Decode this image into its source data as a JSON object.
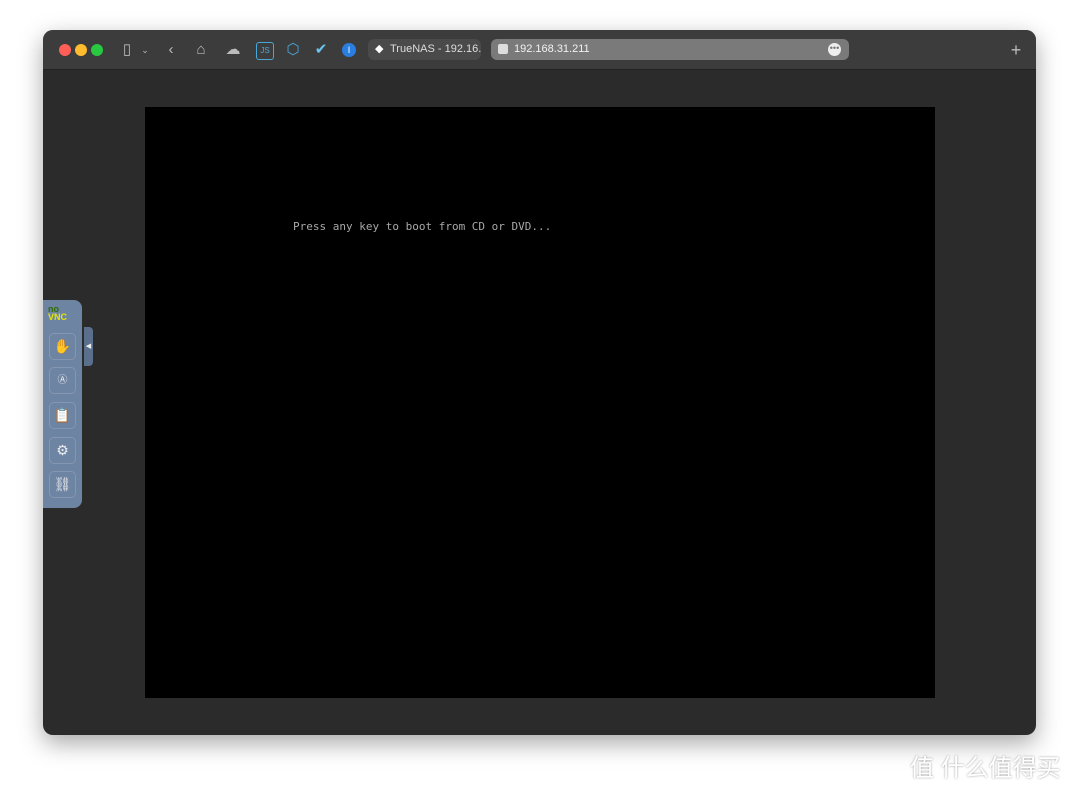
{
  "browser": {
    "tab_title": "TrueNAS - 192.16...",
    "url": "192.168.31.211",
    "new_tab": "+",
    "icons": [
      "sidebar-icon",
      "chevron-down-icon",
      "back-icon",
      "home-icon",
      "cloud-icon",
      "js-icon",
      "cube-icon",
      "check-icon",
      "1password-icon"
    ]
  },
  "screen": {
    "boot_message": "Press any key to boot from CD or DVD..."
  },
  "novnc": {
    "logo_top": "no",
    "logo_bottom": "VNC",
    "buttons": [
      "drag-icon",
      "keyboard-icon",
      "clipboard-icon",
      "settings-icon",
      "disconnect-icon"
    ]
  },
  "watermark": {
    "text": "值 什么值得买"
  },
  "colors": {
    "screen": "#000000",
    "panel": "#6e84a3"
  }
}
